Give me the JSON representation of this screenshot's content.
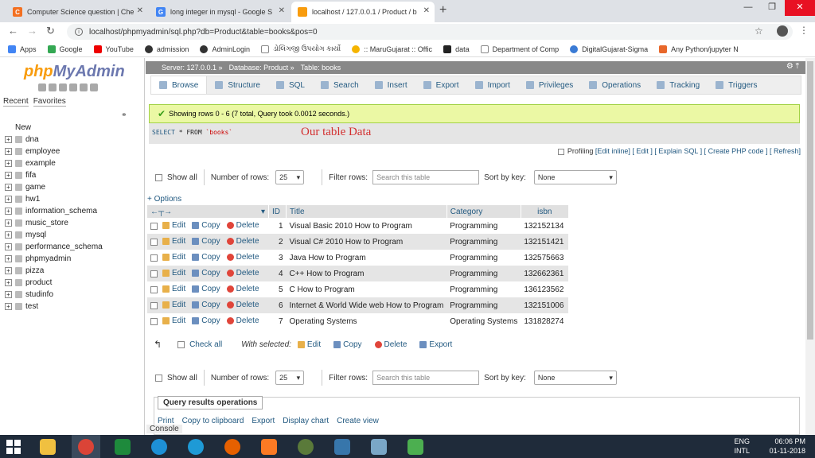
{
  "browser": {
    "tabs": [
      {
        "title": "Computer Science question | Che",
        "active": false
      },
      {
        "title": "long integer in mysql - Google S",
        "active": false
      },
      {
        "title": "localhost / 127.0.0.1 / Product / b",
        "active": true
      }
    ],
    "url": "localhost/phpmyadmin/sql.php?db=Product&table=books&pos=0",
    "bookmarks": [
      "Apps",
      "Google",
      "YouTube",
      "admission",
      "AdminLogin",
      "ડોલિંગજી ઉપયોગ કાર્યો",
      ":: MaruGujarat :: Offic",
      "data",
      "Department of Comp",
      "DigitalGujarat-Sigma",
      "Any Python/jupyter N"
    ]
  },
  "pma": {
    "logo_a": "php",
    "logo_b": "MyAdmin",
    "nav_tabs": [
      "Recent",
      "Favorites"
    ],
    "databases": [
      "New",
      "dna",
      "employee",
      "example",
      "fifa",
      "game",
      "hw1",
      "information_schema",
      "music_store",
      "mysql",
      "performance_schema",
      "phpmyadmin",
      "pizza",
      "product",
      "studinfo",
      "test"
    ],
    "breadcrumb": {
      "server": "Server: 127.0.0.1 »",
      "database": "Database: Product »",
      "table": "Table: books"
    },
    "tabs": [
      "Browse",
      "Structure",
      "SQL",
      "Search",
      "Insert",
      "Export",
      "Import",
      "Privileges",
      "Operations",
      "Tracking",
      "Triggers"
    ],
    "success_msg": "Showing rows 0 - 6 (7 total, Query took 0.0012 seconds.)",
    "sql": {
      "select": "SELECT",
      "star": "* FROM",
      "table": "`books`"
    },
    "annotation": "Our table Data",
    "profiling": {
      "label": "Profiling",
      "links": "[Edit inline] [ Edit ] [ Explain SQL ] [ Create PHP code ] [ Refresh]"
    },
    "controls": {
      "show_all": "Show all",
      "num_rows_label": "Number of rows:",
      "num_rows_value": "25",
      "filter_label": "Filter rows:",
      "filter_placeholder": "Search this table",
      "sort_label": "Sort by key:",
      "sort_value": "None"
    },
    "options_link": "+ Options",
    "columns": [
      "ID",
      "Title",
      "Category",
      "isbn"
    ],
    "row_actions": {
      "edit": "Edit",
      "copy": "Copy",
      "delete": "Delete"
    },
    "rows": [
      [
        "1",
        "Visual Basic 2010 How to Program",
        "Programming",
        "132152134"
      ],
      [
        "2",
        "Visual C# 2010 How to Program",
        "Programming",
        "132151421"
      ],
      [
        "3",
        "Java How to Program",
        "Programming",
        "132575663"
      ],
      [
        "4",
        "C++ How to Program",
        "Programming",
        "132662361"
      ],
      [
        "5",
        "C How to Program",
        "Programming",
        "136123562"
      ],
      [
        "6",
        "Internet & World Wide web How to Program",
        "Programming",
        "132151006"
      ],
      [
        "7",
        "Operating Systems",
        "Operating Systems",
        "131828274"
      ]
    ],
    "with_selected": {
      "check_all": "Check all",
      "label": "With selected:",
      "edit": "Edit",
      "copy": "Copy",
      "delete": "Delete",
      "export": "Export"
    },
    "qro": {
      "legend": "Query results operations",
      "links": [
        "Print",
        "Copy to clipboard",
        "Export",
        "Display chart",
        "Create view"
      ]
    },
    "console": "Console"
  },
  "tray": {
    "lang1": "ENG",
    "lang2": "INTL",
    "time": "06:06 PM",
    "date": "01-11-2018"
  }
}
